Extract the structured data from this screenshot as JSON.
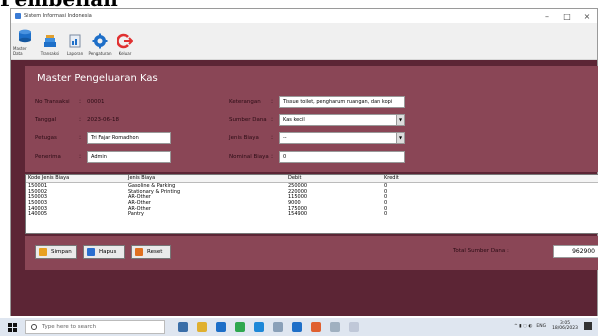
{
  "heading": "Pembelian",
  "window": {
    "title": "Sistem Informasi Indonesia",
    "controls": [
      "–",
      "□",
      "×"
    ]
  },
  "toolbar": {
    "items": [
      {
        "label": "Master Data",
        "icon": "database-icon"
      },
      {
        "label": "Transaksi",
        "icon": "stack-icon"
      },
      {
        "label": "Laporan",
        "icon": "report-icon"
      },
      {
        "label": "Pengaturan",
        "icon": "gear-icon"
      },
      {
        "label": "Keluar",
        "icon": "logout-icon"
      }
    ]
  },
  "panel": {
    "title": "Master Pengeluaran Kas"
  },
  "form": {
    "no_transaksi_label": "No Transaksi",
    "no_transaksi_value": "00001",
    "tanggal_label": "Tanggal",
    "tanggal_value": "2023-06-18",
    "petugas_label": "Petugas",
    "petugas_value": "Tri Fajar Romadhon",
    "penerima_label": "Penerima",
    "penerima_value": "Admin",
    "keterangan_label": "Keterangan",
    "keterangan_value": "Tissue toilet, pengharum ruangan, dan kopi",
    "sumber_dana_label": "Sumber Dana",
    "sumber_dana_value": "Kas kecil",
    "jenis_biaya_label": "Jenis Biaya",
    "jenis_biaya_value": "--",
    "nominal_biaya_label": "Nominal Biaya",
    "nominal_biaya_value": "0",
    "colon": ":"
  },
  "table": {
    "columns": [
      "Kode Jenis Biaya",
      "Jenis Biaya",
      "Debit",
      "Kredit"
    ],
    "rows": [
      {
        "kode": "150001",
        "jenis": "Gasoline & Parking",
        "debit": "250000",
        "kredit": "0"
      },
      {
        "kode": "150002",
        "jenis": "Stationary & Printing",
        "debit": "220000",
        "kredit": "0"
      },
      {
        "kode": "150003",
        "jenis": "AR-Other",
        "debit": "115000",
        "kredit": "0"
      },
      {
        "kode": "150003",
        "jenis": "AR-Other",
        "debit": "9000",
        "kredit": "0"
      },
      {
        "kode": "140003",
        "jenis": "AR-Other",
        "debit": "175000",
        "kredit": "0"
      },
      {
        "kode": "140005",
        "jenis": "Pantry",
        "debit": "154900",
        "kredit": "0"
      }
    ]
  },
  "actions": {
    "simpan": "Simpan",
    "hapus": "Hapus",
    "reset": "Reset",
    "total_label": "Total Sumber Dana :",
    "total_value": "962900"
  },
  "taskbar": {
    "search_placeholder": "Type here to search",
    "lang": "ENG",
    "time": "3:05",
    "date": "18/06/2023"
  },
  "colors": {
    "dark_maroon": "#5c2535",
    "panel_maroon": "#8a4656"
  }
}
